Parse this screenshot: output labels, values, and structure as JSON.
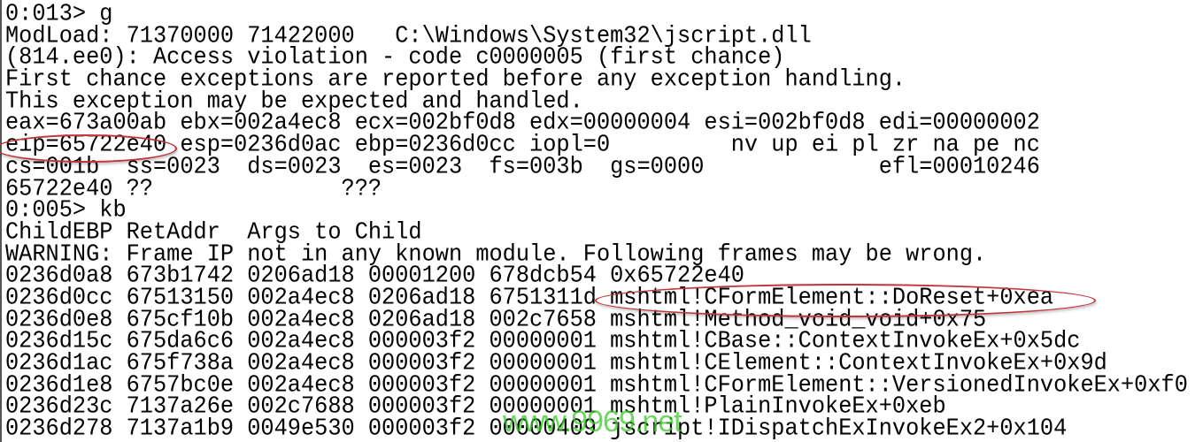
{
  "console": {
    "lines": [
      "0:013> g",
      "ModLoad: 71370000 71422000   C:\\Windows\\System32\\jscript.dll",
      "(814.ee0): Access violation - code c0000005 (first chance)",
      "First chance exceptions are reported before any exception handling.",
      "This exception may be expected and handled.",
      "eax=673a00ab ebx=002a4ec8 ecx=002bf0d8 edx=00000004 esi=002bf0d8 edi=00000002",
      "eip=65722e40 esp=0236d0ac ebp=0236d0cc iopl=0         nv up ei pl zr na pe nc",
      "cs=001b  ss=0023  ds=0023  es=0023  fs=003b  gs=0000             efl=00010246",
      "65722e40 ??              ???",
      "0:005> kb",
      "ChildEBP RetAddr  Args to Child",
      "WARNING: Frame IP not in any known module. Following frames may be wrong.",
      "0236d0a8 673b1742 0206ad18 00001200 678dcb54 0x65722e40",
      "0236d0cc 67513150 002a4ec8 0206ad18 6751311d mshtml!CFormElement::DoReset+0xea",
      "0236d0e8 675cf10b 002a4ec8 0206ad18 002c7658 mshtml!Method_void_void+0x75",
      "0236d15c 675da6c6 002a4ec8 000003f2 00000001 mshtml!CBase::ContextInvokeEx+0x5dc",
      "0236d1ac 675f738a 002a4ec8 000003f2 00000001 mshtml!CElement::ContextInvokeEx+0x9d",
      "0236d1e8 6757bc0e 002a4ec8 000003f2 00000001 mshtml!CFormElement::VersionedInvokeEx+0xf0",
      "0236d23c 7137a26e 002c7688 000003f2 00000001 mshtml!PlainInvokeEx+0xeb",
      "0236d278 7137a1b9 0049e530 000003f2 00000409 jscript!IDispatchExInvokeEx2+0x104"
    ]
  },
  "highlights": {
    "color": "#c0343a",
    "items": [
      "eip=65722e40",
      "mshtml!CFormElement::DoReset+0xea"
    ]
  },
  "watermark": {
    "text": "www.9969.net",
    "color": "#3cc828"
  }
}
